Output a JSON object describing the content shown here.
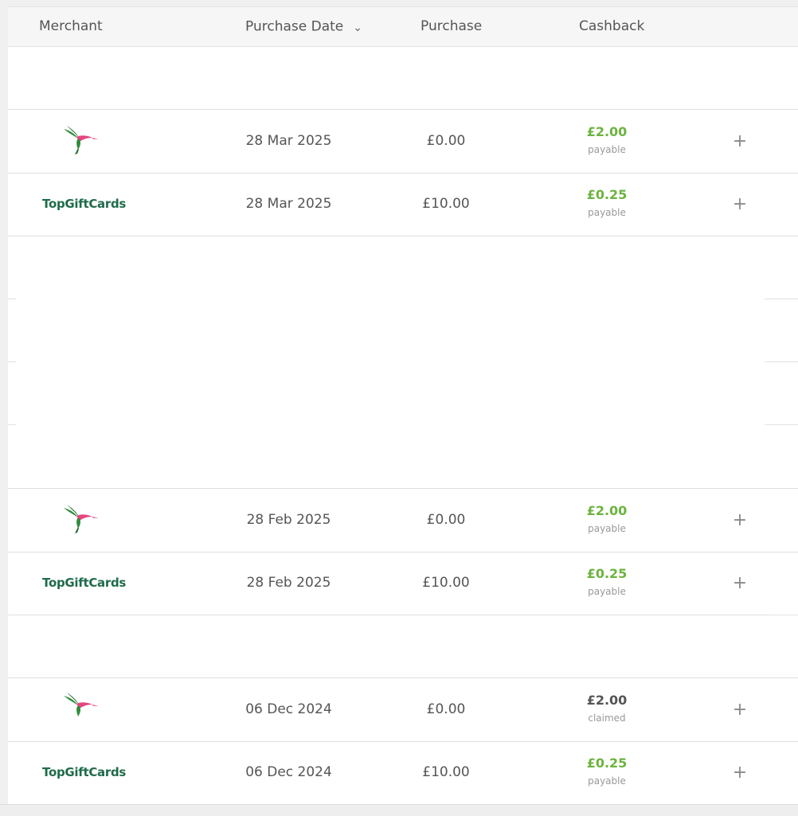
{
  "table": {
    "headers": {
      "merchant": "Merchant",
      "purchase_date": "Purchase Date",
      "purchase": "Purchase",
      "cashback": "Cashback"
    },
    "sort_icon": "chevron-down-icon",
    "rows": [
      {
        "merchant_logo": "hummingbird-logo",
        "merchant_text": "",
        "date": "28 Mar 2025",
        "purchase": "£0.00",
        "cashback": "£2.00",
        "status": "payable"
      },
      {
        "merchant_logo": "topgiftcards-logo",
        "merchant_text": "TopGiftCards",
        "date": "28 Mar 2025",
        "purchase": "£10.00",
        "cashback": "£0.25",
        "status": "payable"
      },
      {
        "merchant_logo": "hummingbird-logo",
        "merchant_text": "",
        "date": "28 Feb 2025",
        "purchase": "£0.00",
        "cashback": "£2.00",
        "status": "payable"
      },
      {
        "merchant_logo": "topgiftcards-logo",
        "merchant_text": "TopGiftCards",
        "date": "28 Feb 2025",
        "purchase": "£10.00",
        "cashback": "£0.25",
        "status": "payable"
      },
      {
        "merchant_logo": "hummingbird-logo",
        "merchant_text": "",
        "date": "06 Dec 2024",
        "purchase": "£0.00",
        "cashback": "£2.00",
        "status": "claimed"
      },
      {
        "merchant_logo": "topgiftcards-logo",
        "merchant_text": "TopGiftCards",
        "date": "06 Dec 2024",
        "purchase": "£10.00",
        "cashback": "£0.25",
        "status": "payable"
      }
    ],
    "expand_symbol": "+"
  },
  "colors": {
    "payable": "#6cb33f",
    "claimed": "#555555",
    "brand_green": "#1f6b4b",
    "bird_green": "#2e8b3a",
    "bird_pink": "#e6457f"
  }
}
